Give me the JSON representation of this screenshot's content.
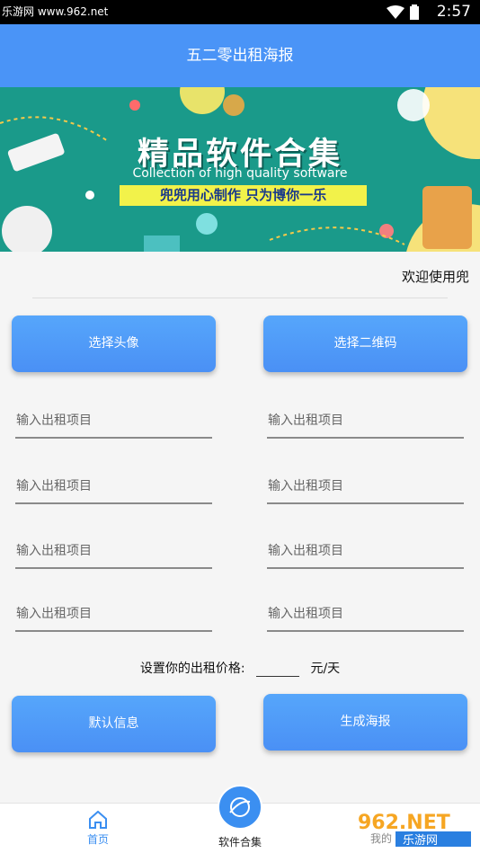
{
  "status_bar": {
    "watermark": "乐游网 www.962.net",
    "time": "2:57"
  },
  "header": {
    "title": "五二零出租海报"
  },
  "banner": {
    "title": "精品软件合集",
    "subtitle": "Collection of high quality software",
    "slogan": "兜兜用心制作 只为博你一乐"
  },
  "welcome": "欢迎使用兜",
  "buttons": {
    "choose_avatar": "选择头像",
    "choose_qrcode": "选择二维码",
    "default_info": "默认信息",
    "generate_poster": "生成海报"
  },
  "inputs": {
    "placeholder": "输入出租项目",
    "fields": [
      "",
      "",
      "",
      "",
      "",
      "",
      "",
      ""
    ]
  },
  "price": {
    "label": "设置你的出租价格:",
    "unit": "元/天"
  },
  "tabbar": {
    "home": "首页",
    "software": "软件合集",
    "mine": "我的"
  },
  "colors": {
    "accent": "#4a94f7",
    "tab_active": "#3b8ff1"
  },
  "logo_text": {
    "brand": "962.NET",
    "name": "乐游网"
  }
}
